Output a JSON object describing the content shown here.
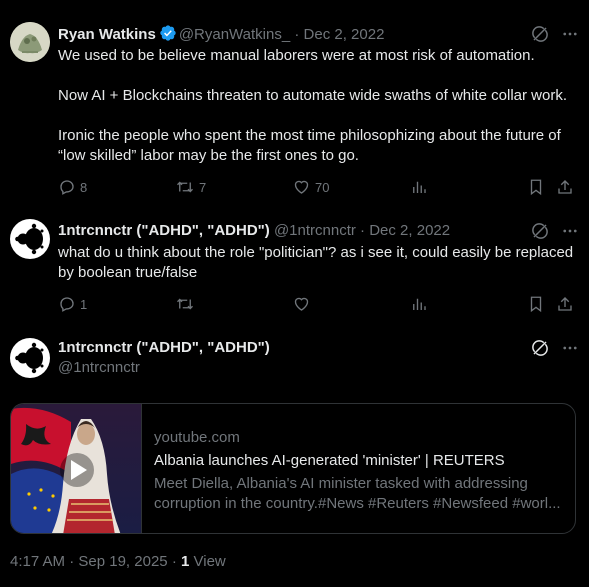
{
  "tweets": [
    {
      "author_name": "Ryan Watkins",
      "handle": "@RyanWatkins_",
      "separator": "·",
      "date": "Dec 2, 2022",
      "verified": true,
      "text": "We used to be believe manual laborers were at most risk of automation.\n\nNow AI + Blockchains threaten to automate wide swaths of white collar work.\n\nIronic the people who spent the most time philosophizing about the future of “low skilled” labor may be the first ones to go.",
      "replies": "8",
      "reposts": "7",
      "likes": "70"
    },
    {
      "author_name": "1ntrcnnctr (\"ADHD\", \"ADHD\")",
      "handle": "@1ntrcnnctr",
      "separator": "·",
      "date": "Dec 2, 2022",
      "text": "what do u think about the role \"politician\"? as i see it, could easily be replaced by boolean true/false",
      "replies": "1",
      "reposts": "",
      "likes": ""
    }
  ],
  "main_post": {
    "author_name": "1ntrcnnctr (\"ADHD\", \"ADHD\")",
    "handle": "@1ntrcnnctr",
    "card": {
      "domain": "youtube.com",
      "title": "Albania launches AI-generated 'minister' | REUTERS",
      "description": "Meet Diella, Albania's AI minister tasked with addressing corruption in the country.#News #Reuters #Newsfeed #worl..."
    },
    "time": "4:17 AM",
    "separator": "·",
    "date": "Sep 19, 2025",
    "views_count": "1",
    "views_label": "View"
  },
  "colors": {
    "background": "#000000",
    "text_primary": "#e7e9ea",
    "text_secondary": "#71767b",
    "verified_blue": "#1d9bf0",
    "border": "#2f3336"
  },
  "icons": [
    "grok-icon",
    "more-icon",
    "reply-icon",
    "repost-icon",
    "like-icon",
    "views-icon",
    "bookmark-icon",
    "share-icon",
    "verified-badge-icon",
    "play-icon"
  ]
}
